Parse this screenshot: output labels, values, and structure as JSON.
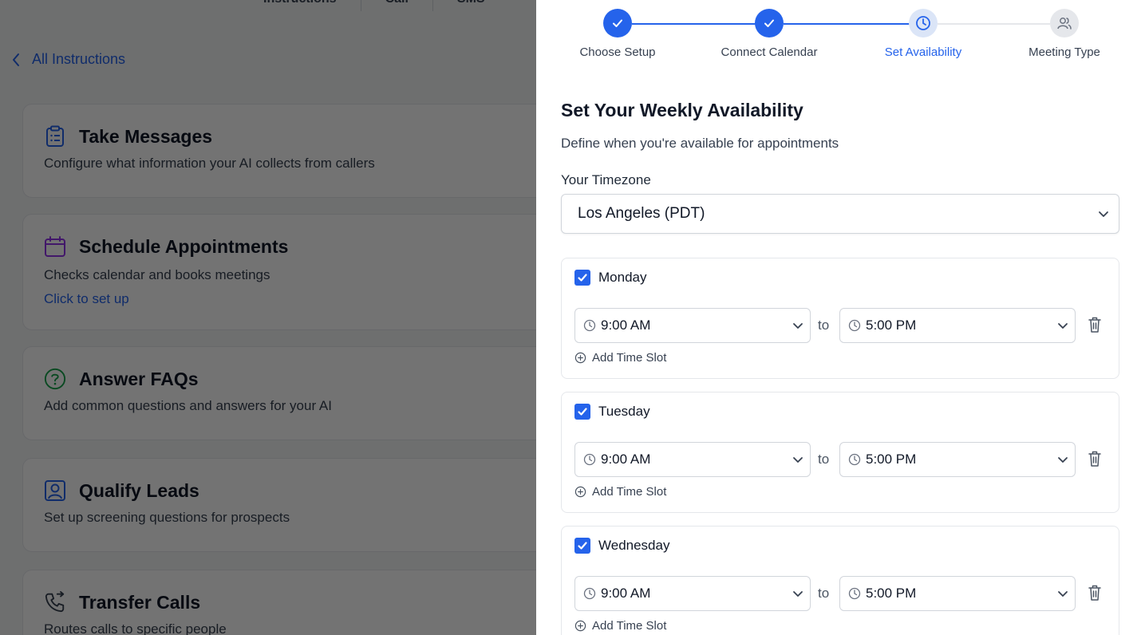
{
  "background_page": {
    "tabs": [
      "Instructions",
      "Call",
      "SMS"
    ],
    "back_link": "All Instructions",
    "cards": [
      {
        "icon": "clipboard-list-icon",
        "title": "Take Messages",
        "description": "Configure what information your AI collects from callers",
        "link": ""
      },
      {
        "icon": "calendar-icon",
        "title": "Schedule Appointments",
        "description": "Checks calendar and books meetings",
        "link": "Click to set up"
      },
      {
        "icon": "question-circle-icon",
        "title": "Answer FAQs",
        "description": "Add common questions and answers for your AI",
        "link": ""
      },
      {
        "icon": "user-square-icon",
        "title": "Qualify Leads",
        "description": "Set up screening questions for prospects",
        "link": ""
      },
      {
        "icon": "phone-forward-icon",
        "title": "Transfer Calls",
        "description": "Routes calls to specific people",
        "link": ""
      }
    ]
  },
  "stepper": {
    "steps": [
      {
        "label": "Choose Setup",
        "state": "done"
      },
      {
        "label": "Connect Calendar",
        "state": "done"
      },
      {
        "label": "Set Availability",
        "state": "current"
      },
      {
        "label": "Meeting Type",
        "state": "todo"
      }
    ]
  },
  "availability": {
    "title": "Set Your Weekly Availability",
    "description": "Define when you're available for appointments",
    "timezone_label": "Your Timezone",
    "timezone_value": "Los Angeles (PDT)",
    "to_label": "to",
    "add_slot_label": "Add Time Slot",
    "days": [
      {
        "name": "Monday",
        "checked": true,
        "start": "9:00 AM",
        "end": "5:00 PM"
      },
      {
        "name": "Tuesday",
        "checked": true,
        "start": "9:00 AM",
        "end": "5:00 PM"
      },
      {
        "name": "Wednesday",
        "checked": true,
        "start": "9:00 AM",
        "end": "5:00 PM"
      }
    ]
  },
  "colors": {
    "accent": "#2563eb",
    "overlay": "#000000",
    "border": "#d1d5db"
  }
}
